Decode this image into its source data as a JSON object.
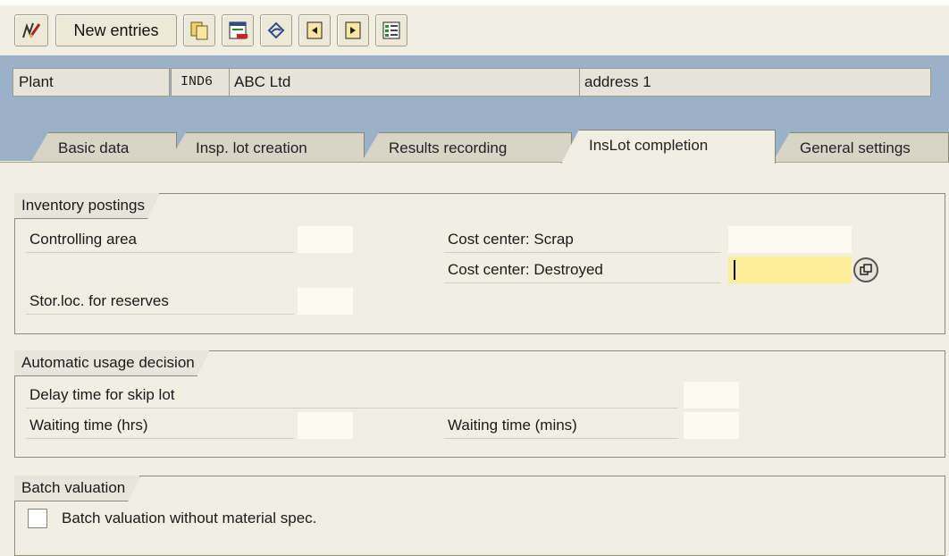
{
  "toolbar": {
    "new_entries_label": "New entries",
    "icons": [
      "display-change-icon",
      "copy-icon",
      "delete-icon",
      "undo-icon",
      "previous-entry-icon",
      "next-entry-icon",
      "select-all-icon"
    ]
  },
  "header": {
    "plant_label": "Plant",
    "plant_code": "IND6",
    "plant_name": "ABC Ltd",
    "plant_address": "address 1"
  },
  "tabs": [
    {
      "label": "Basic data",
      "active": false
    },
    {
      "label": "Insp. lot creation",
      "active": false
    },
    {
      "label": "Results recording",
      "active": false
    },
    {
      "label": "InsLot completion",
      "active": true
    },
    {
      "label": "General settings",
      "active": false
    }
  ],
  "inventory_postings": {
    "title": "Inventory postings",
    "controlling_area_label": "Controlling area",
    "controlling_area_value": "",
    "stor_loc_label": "Stor.loc. for reserves",
    "stor_loc_value": "",
    "cost_center_scrap_label": "Cost center: Scrap",
    "cost_center_scrap_value": "",
    "cost_center_destroyed_label": "Cost center: Destroyed",
    "cost_center_destroyed_value": ""
  },
  "automatic_usage_decision": {
    "title": "Automatic usage decision",
    "delay_time_label": "Delay time for skip lot",
    "delay_time_value": "",
    "waiting_hrs_label": "Waiting time (hrs)",
    "waiting_hrs_value": "",
    "waiting_mins_label": "Waiting time (mins)",
    "waiting_mins_value": ""
  },
  "batch_valuation": {
    "title": "Batch valuation",
    "checkbox_label": "Batch valuation without material spec.",
    "checked": false
  },
  "colors": {
    "header_band": "#9ab1c8",
    "background": "#f1efe2",
    "input_focus": "#ffee99",
    "input_empty": "#fcfbee"
  }
}
